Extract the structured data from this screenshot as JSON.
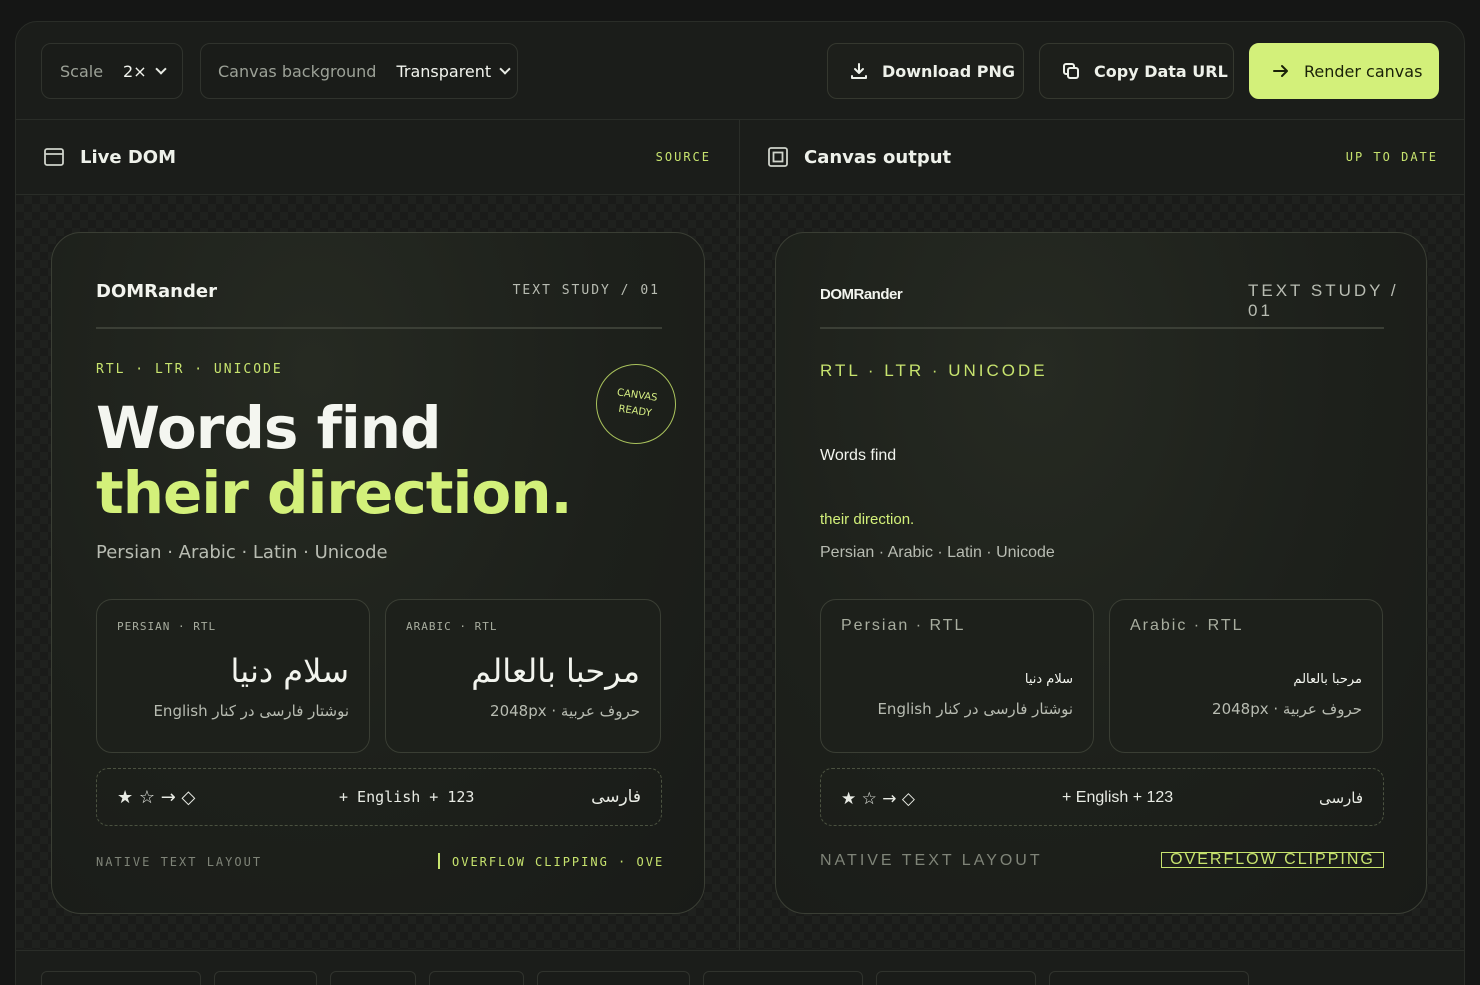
{
  "toolbar": {
    "scale_label": "Scale",
    "scale_value": "2×",
    "bg_label": "Canvas background",
    "bg_value": "Transparent",
    "download_label": "Download PNG",
    "copy_label": "Copy Data URL",
    "render_label": "Render canvas"
  },
  "left_pane": {
    "title": "Live DOM",
    "status": "SOURCE"
  },
  "right_pane": {
    "title": "Canvas output",
    "status": "UP TO DATE"
  },
  "card": {
    "brand": "DOMRander",
    "study": "TEXT STUDY / 01",
    "tags": "RTL · LTR · UNICODE",
    "headline_1": "Words find",
    "headline_2": "their direction.",
    "subtitle": "Persian · Arabic · Latin · Unicode",
    "badge_1": "CANVAS",
    "badge_2": "READY",
    "persian_key": "PERSIAN · RTL",
    "persian_main": "سلام دنیا",
    "persian_sub": "نوشتار فارسی در کنار English",
    "arabic_key": "ARABIC · RTL",
    "arabic_main": "مرحبا بالعالم",
    "arabic_sub": "حروف عربية · 2048px",
    "symbols": "★ ☆ → ◇",
    "mixed": "+ English + 123",
    "farsi": "فارسی",
    "foot_left": "NATIVE TEXT LAYOUT",
    "foot_right": "OVERFLOW CLIPPING · OVERFLOW",
    "foot_right_canvas": "OVERFLOW CLIPPING"
  },
  "canvas_card": {
    "persian_key": "Persian · RTL",
    "arabic_key": "Arabic · RTL"
  },
  "colors": {
    "accent": "#d3f07a",
    "accent_text": "#c7e36e",
    "bg": "#1b1d1a"
  }
}
